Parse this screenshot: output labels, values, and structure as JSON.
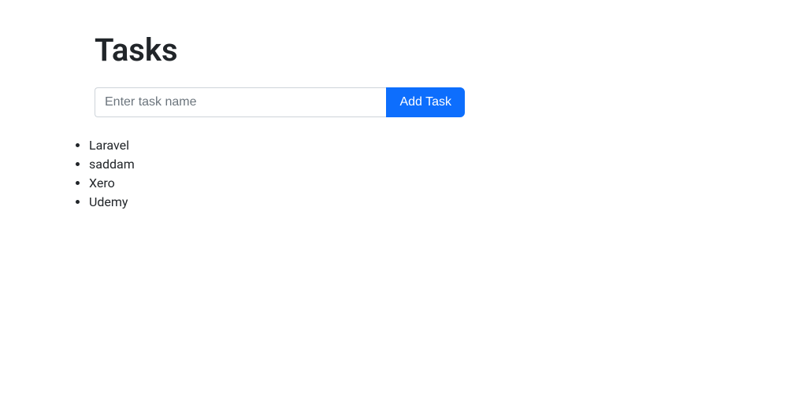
{
  "header": {
    "title": "Tasks"
  },
  "form": {
    "input_placeholder": "Enter task name",
    "button_label": "Add Task"
  },
  "tasks": [
    {
      "name": "Laravel"
    },
    {
      "name": "saddam"
    },
    {
      "name": "Xero"
    },
    {
      "name": "Udemy"
    }
  ]
}
